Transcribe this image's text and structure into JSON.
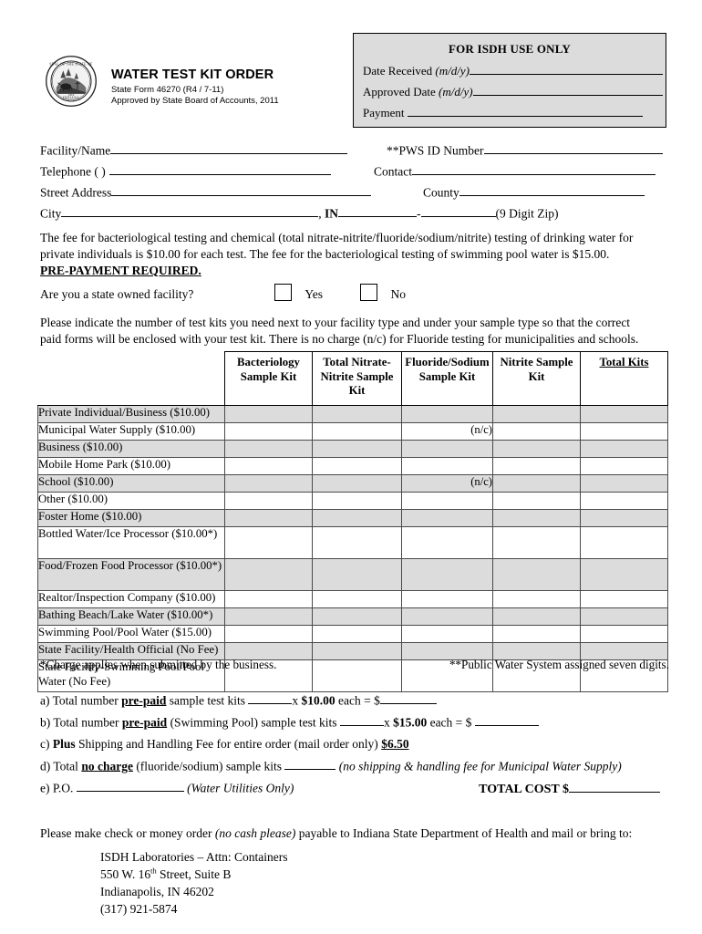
{
  "header": {
    "title": "WATER TEST KIT ORDER",
    "form_number": "State Form 46270 (R4 / 7-11)",
    "approval": "Approved by State Board of Accounts, 2011",
    "seal_alt": "Seal of the State of Indiana 1816"
  },
  "isdh_box": {
    "title": "FOR ISDH USE ONLY",
    "rows": [
      {
        "label": "Date Received ",
        "italic": "(m/d/y)"
      },
      {
        "label": "Approved Date ",
        "italic": "(m/d/y)"
      },
      {
        "label": "Payment ",
        "italic": ""
      }
    ]
  },
  "fields": {
    "facility_name": "Facility/Name",
    "pws_id": "**PWS ID Number",
    "telephone": "Telephone   (        )",
    "contact": "Contact",
    "street_address": "Street Address",
    "county": "County",
    "city": "City",
    "state_abbr": "IN",
    "zip_note": "(9 Digit Zip)"
  },
  "fee_paragraph": {
    "line1": "The fee for bacteriological testing and chemical (total nitrate-nitrite/fluoride/sodium/nitrite) testing of drinking water for",
    "line2": "private individuals is $10.00 for each test.  The fee for the bacteriological testing of swimming pool water is $15.00.",
    "emphasis": "PRE-PAYMENT REQUIRED."
  },
  "state_owned": {
    "question": "Are you a state owned facility?",
    "yes_label": "Yes",
    "no_label": "No"
  },
  "instructions": {
    "line1": "Please indicate the number of test kits you need next to your facility type and under your sample type so that the correct",
    "line2": "paid forms will be enclosed with your test kit. There is no charge (n/c) for Fluoride testing for municipalities and schools."
  },
  "table": {
    "columns": [
      "Bacteriology Sample Kit",
      "Total Nitrate-Nitrite Sample Kit",
      "Fluoride/Sodium Sample Kit",
      "Nitrite Sample Kit",
      "Total Kits"
    ],
    "rows": [
      {
        "label": "Private Individual/Business  ($10.00)",
        "values": [
          "",
          "",
          "",
          "",
          ""
        ]
      },
      {
        "label": "Municipal Water Supply  ($10.00)",
        "values": [
          "",
          "",
          "(n/c)",
          "",
          ""
        ]
      },
      {
        "label": "Business    ($10.00)",
        "values": [
          "",
          "",
          "",
          "",
          ""
        ]
      },
      {
        "label": "Mobile Home Park    ($10.00)",
        "values": [
          "",
          "",
          "",
          "",
          ""
        ]
      },
      {
        "label": "School   ($10.00)",
        "values": [
          "",
          "",
          "(n/c)",
          "",
          ""
        ]
      },
      {
        "label": "Other   ($10.00)",
        "values": [
          "",
          "",
          "",
          "",
          ""
        ]
      },
      {
        "label": "Foster Home   ($10.00)",
        "values": [
          "",
          "",
          "",
          "",
          ""
        ]
      },
      {
        "label": "Bottled Water/Ice Processor ($10.00*)",
        "values": [
          "",
          "",
          "",
          "",
          ""
        ]
      },
      {
        "label": "Food/Frozen Food Processor ($10.00*)",
        "values": [
          "",
          "",
          "",
          "",
          ""
        ]
      },
      {
        "label": "Realtor/Inspection Company ($10.00)",
        "values": [
          "",
          "",
          "",
          "",
          ""
        ]
      },
      {
        "label": "Bathing Beach/Lake Water  ($10.00*)",
        "values": [
          "",
          "",
          "",
          "",
          ""
        ]
      },
      {
        "label": "Swimming Pool/Pool Water ($15.00)",
        "values": [
          "",
          "",
          "",
          "",
          ""
        ]
      },
      {
        "label": "State Facility/Health Official (No Fee)",
        "values": [
          "",
          "",
          "",
          "",
          ""
        ]
      },
      {
        "label": "State Facility-Swimming Pool/Pool Water (No Fee)",
        "values": [
          "",
          "",
          "",
          "",
          ""
        ]
      }
    ]
  },
  "footnotes": {
    "left": "*Charge applies when submitted by the business.",
    "right": "**Public Water System assigned seven digits."
  },
  "items": {
    "a_prefix": "a) Total number ",
    "a_bold": "pre-paid",
    "a_mid": " sample test kits ",
    "a_x": "x ",
    "a_price": "$10.00",
    "a_suffix": " each = $",
    "b_prefix": "b) Total number ",
    "b_bold": "pre-paid",
    "b_mid": " (Swimming Pool) sample test kits ",
    "b_x": "x ",
    "b_price": "$15.00",
    "b_suffix": " each = $ ",
    "c_prefix": "c) ",
    "c_bold": "Plus",
    "c_mid": " Shipping and Handling Fee for entire order (mail order only) ",
    "c_amount": "$6.50",
    "d_prefix": "d) Total ",
    "d_bold": "no charge",
    "d_mid": " (fluoride/sodium) sample kits ",
    "d_italic": "(no shipping & handling fee for Municipal Water Supply)",
    "e_prefix": "e) P.O. ",
    "e_italic": "(Water Utilities Only)",
    "total_cost_label": "TOTAL COST $"
  },
  "closing": {
    "line_prefix": "Please make check or money order ",
    "line_italic": "(no cash please)",
    "line_suffix": " payable to Indiana State Department of Health and mail or bring to:",
    "addr1": "ISDH Laboratories – Attn: Containers",
    "addr2_pre": "550 W. 16",
    "addr2_sup": "th",
    "addr2_post": " Street, Suite B",
    "addr3": "Indianapolis, IN  46202",
    "addr4": "(317) 921-5874"
  }
}
